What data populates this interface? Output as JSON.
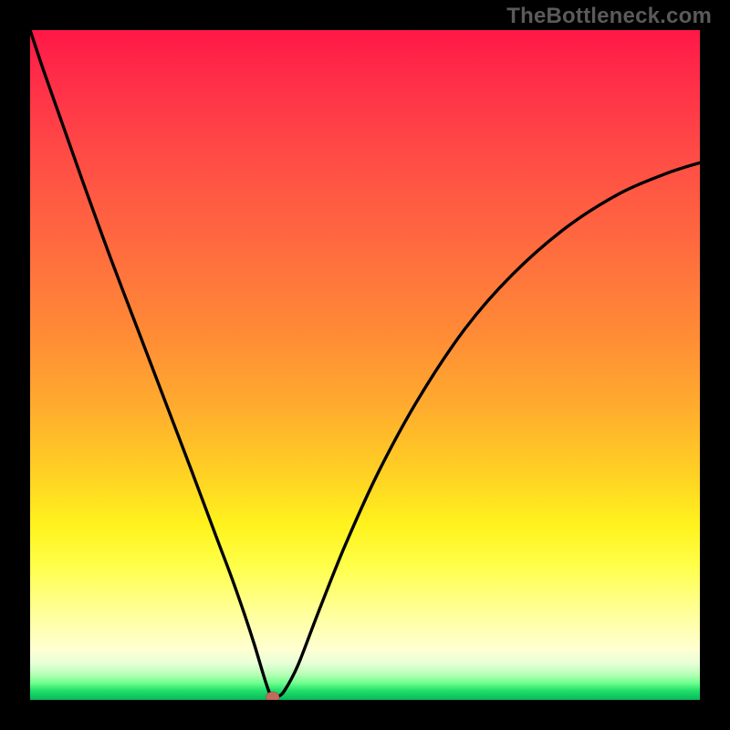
{
  "watermark": "TheBottleneck.com",
  "chart_data": {
    "type": "line",
    "title": "",
    "xlabel": "",
    "ylabel": "",
    "xlim": [
      0,
      100
    ],
    "ylim": [
      0,
      100
    ],
    "grid": false,
    "legend": false,
    "series": [
      {
        "name": "bottleneck-curve",
        "x": [
          0,
          2,
          5,
          8,
          12,
          16,
          20,
          24,
          28,
          30,
          32,
          33.5,
          35,
          35.8,
          36.2,
          37,
          38,
          40,
          43,
          47,
          52,
          58,
          65,
          72,
          80,
          88,
          95,
          100
        ],
        "y": [
          100,
          94,
          85.5,
          77,
          66,
          55.5,
          45,
          34.5,
          23.8,
          18.5,
          12.8,
          8.2,
          3.2,
          0.9,
          0.4,
          0.5,
          1.4,
          5.2,
          13,
          23,
          34,
          45,
          55.5,
          63.5,
          70.5,
          75.6,
          78.6,
          80.2
        ],
        "minimum_point": {
          "x": 36.2,
          "y": 0.4
        }
      }
    ],
    "background_gradient": {
      "orientation": "vertical",
      "stops": [
        {
          "pos": 0,
          "color": "#ff1846"
        },
        {
          "pos": 0.45,
          "color": "#ff8a36"
        },
        {
          "pos": 0.74,
          "color": "#fff31e"
        },
        {
          "pos": 0.93,
          "color": "#ffffd2"
        },
        {
          "pos": 1.0,
          "color": "#08b85a"
        }
      ]
    },
    "minimum_marker": {
      "x": 36.2,
      "y": 0.4,
      "color": "#c46a5a"
    }
  }
}
